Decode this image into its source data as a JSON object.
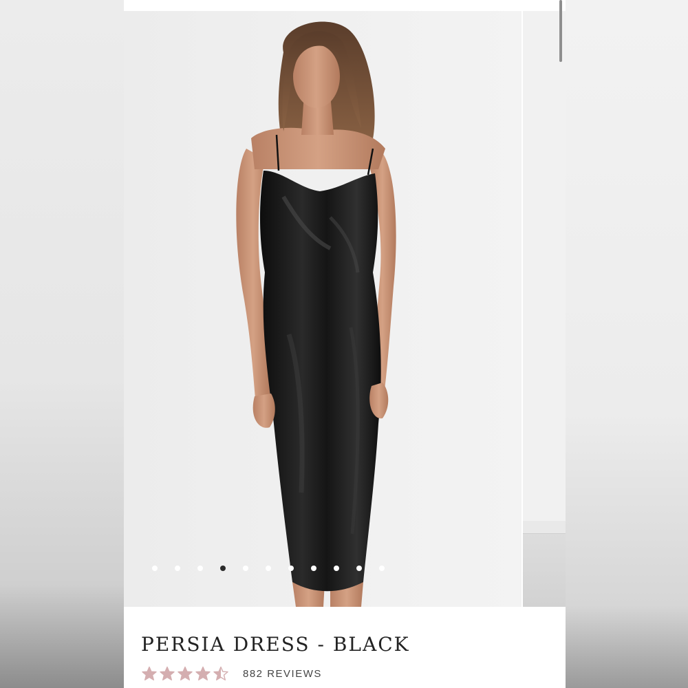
{
  "product": {
    "title": "PERSIA DRESS - BLACK",
    "rating": 4.5,
    "rating_max": 5,
    "reviews_label": "882 REVIEWS",
    "star_color": "#d4aeb0",
    "star_empty_color": "#ead6d7"
  },
  "gallery": {
    "image_alt": "Model wearing black satin cowl neck midi slip dress",
    "slide_count": 11,
    "active_slide": 4
  },
  "colors": {
    "dot_active": "#2a2a2a",
    "dot_inactive": "#ffffff",
    "dress": "#141414"
  }
}
